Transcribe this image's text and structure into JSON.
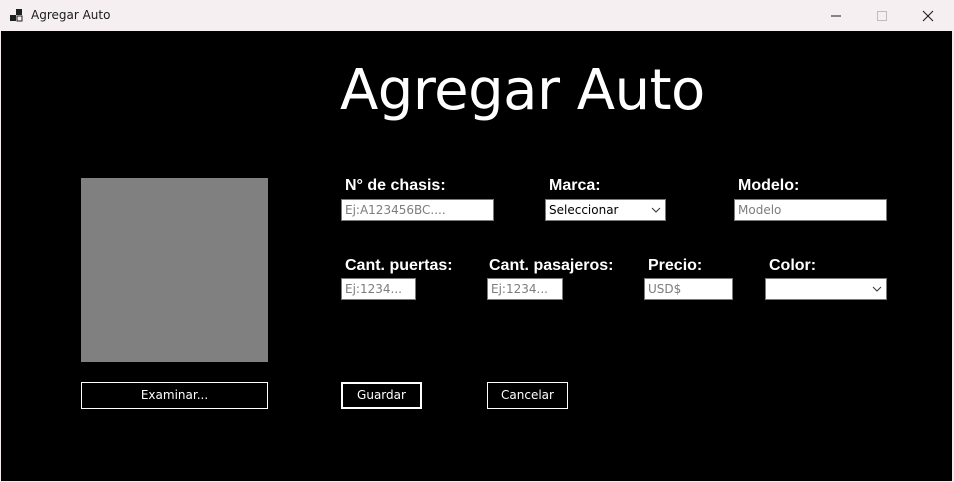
{
  "window": {
    "title": "Agregar Auto",
    "icons": {
      "app": "app-icon",
      "minimize": "minimize-icon",
      "maximize": "maximize-icon",
      "close": "close-icon"
    }
  },
  "form": {
    "heading": "Agregar Auto",
    "labels": {
      "chasis": "N° de chasis:",
      "marca": "Marca:",
      "modelo": "Modelo:",
      "puertas": "Cant. puertas:",
      "pasajeros": "Cant. pasajeros:",
      "precio": "Precio:",
      "color": "Color:"
    },
    "placeholders": {
      "chasis": "Ej:A123456BC....",
      "modelo": "Modelo",
      "puertas": "Ej:1234...",
      "pasajeros": "Ej:1234...",
      "precio": "USD$"
    },
    "marca_selected": "Seleccionar",
    "color_selected": "",
    "buttons": {
      "examinar": "Examinar...",
      "guardar": "Guardar",
      "cancelar": "Cancelar"
    }
  },
  "colors": {
    "background": "#000000",
    "picture_placeholder": "#808080",
    "titlebar": "#f6eff1"
  }
}
